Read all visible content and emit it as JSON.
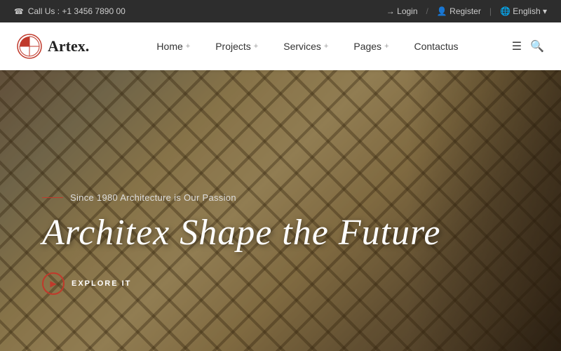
{
  "topbar": {
    "phone_icon": "☎",
    "call_label": "Call Us : +1 3456 7890 00",
    "login_icon": "→",
    "login_label": "Login",
    "register_icon": "👤",
    "register_label": "Register",
    "globe_icon": "🌐",
    "language_label": "English",
    "chevron": "▾"
  },
  "navbar": {
    "logo_text": "Artex.",
    "nav_items": [
      {
        "label": "Home",
        "has_plus": true
      },
      {
        "label": "Projects",
        "has_plus": true
      },
      {
        "label": "Services",
        "has_plus": true
      },
      {
        "label": "Pages",
        "has_plus": true
      },
      {
        "label": "Contactus",
        "has_plus": false
      }
    ]
  },
  "hero": {
    "tagline": "Since 1980 Architecture is Our Passion",
    "title": "Architex Shape the Future",
    "explore_label": "EXPLORE IT"
  }
}
